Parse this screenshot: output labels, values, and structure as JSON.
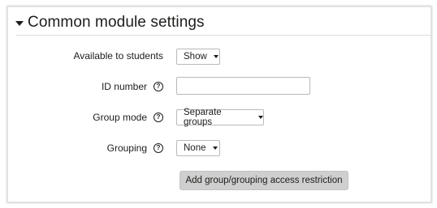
{
  "section": {
    "title": "Common module settings"
  },
  "fields": {
    "available": {
      "label": "Available to students",
      "value": "Show"
    },
    "idnumber": {
      "label": "ID number",
      "value": ""
    },
    "groupmode": {
      "label": "Group mode",
      "value": "Separate groups"
    },
    "grouping": {
      "label": "Grouping",
      "value": "None"
    }
  },
  "actions": {
    "add_restriction_label": "Add group/grouping access restriction"
  },
  "colors": {
    "button_bg": "#cfcfcf",
    "border": "#b9b9b9",
    "text": "#1d1d1b"
  }
}
